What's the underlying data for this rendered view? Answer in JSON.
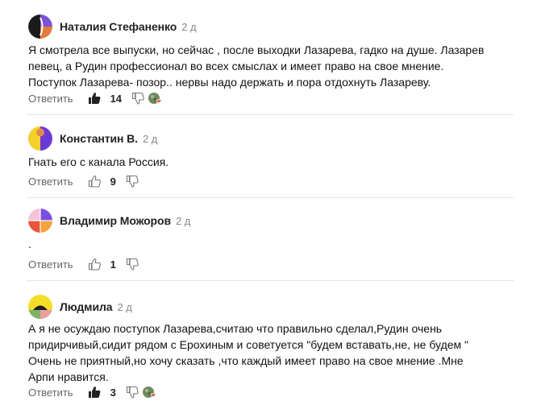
{
  "reply_label": "Ответить",
  "comments": [
    {
      "author": "Наталия Стефаненко",
      "time": "2 д",
      "text": "Я смотрела все выпуски, но сейчас , после выходки Лазарева, гадко на душе. Лазарев\nпевец, а Рудин профессионал во всех смыслах и имеет право на свое мнение.\nПоступок Лазарева- позор.. нервы надо держать и пора отдохнуть Лазареву.",
      "likes": "14",
      "liked": true,
      "avatar_colors": [
        "#1b1b1b",
        "#ffffff",
        "#e37b3f",
        "#7b53d8"
      ]
    },
    {
      "author": "Константин В.",
      "time": "2 д",
      "text": "Гнать его с канала Россия.",
      "likes": "9",
      "liked": false,
      "avatar_colors": [
        "#f4d12a",
        "#6b3ad6",
        "#e28a4e",
        "#c1b6ea"
      ]
    },
    {
      "author": "Владимир Можоров",
      "time": "2 д",
      "text": ".",
      "likes": "1",
      "liked": false,
      "avatar_colors": [
        "#7a4ee0",
        "#e9553a",
        "#f5c3d7",
        "#f2a33a"
      ]
    },
    {
      "author": "Людмила",
      "time": "2 д",
      "text": "А я не осуждаю поступок Лазарева,считаю что правильно сделал,Рудин очень\nпридирчивый,сидит рядом с Ерохиным и советуется \"будем вставать,не, не будем \"\nОчень не приятный,но хочу сказать ,что каждый имеет право на свое мнение .Мне\nАрпи нравится.",
      "likes": "3",
      "liked": true,
      "avatar_colors": [
        "#f4de2a",
        "#f4de2a",
        "#7fb36b",
        "#e8a0a0"
      ]
    }
  ]
}
